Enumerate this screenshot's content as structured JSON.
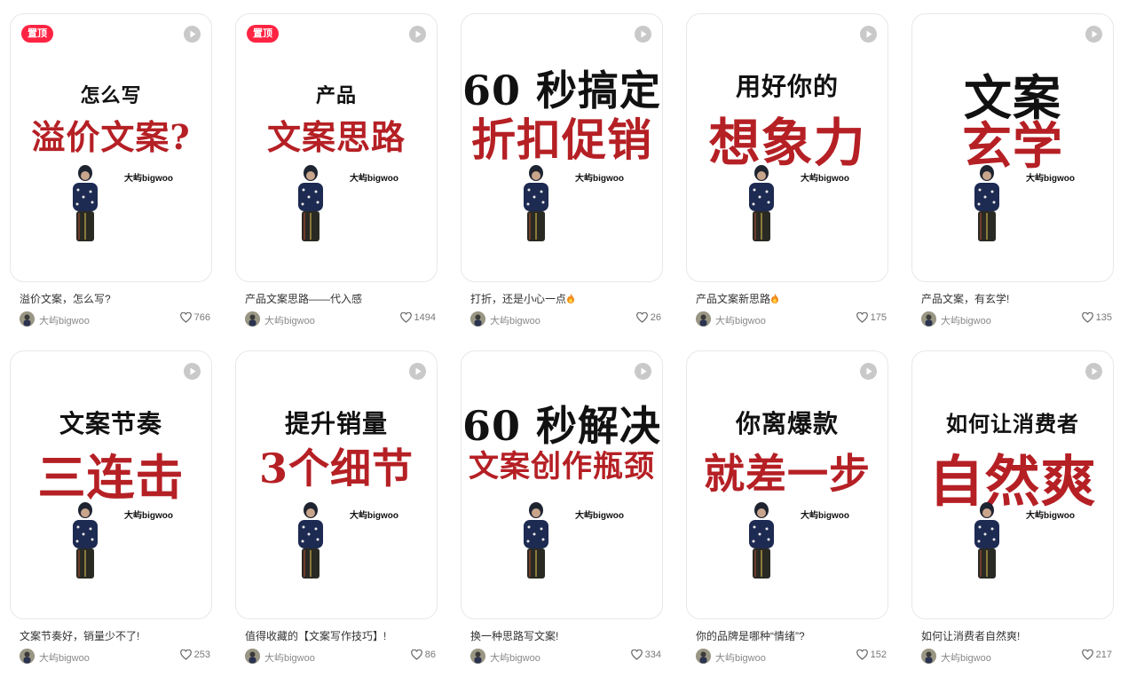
{
  "notes": [
    {
      "pinned": true,
      "pin_label": "置顶",
      "cover": [
        {
          "text": "怎么写",
          "color": "black"
        },
        {
          "text": "溢价文案?",
          "color": "red"
        }
      ],
      "brand": "大屿bigwoo",
      "title": "溢价文案，怎么写?",
      "fire": false,
      "author": "大屿bigwoo",
      "likes": "766"
    },
    {
      "pinned": true,
      "pin_label": "置顶",
      "cover": [
        {
          "text": "产品",
          "color": "black"
        },
        {
          "text": "文案思路",
          "color": "red"
        }
      ],
      "brand": "大屿bigwoo",
      "title": "产品文案思路——代入感",
      "fire": false,
      "author": "大屿bigwoo",
      "likes": "1494"
    },
    {
      "pinned": false,
      "cover": [
        {
          "text": "60 秒搞定",
          "color": "black"
        },
        {
          "text": "折扣促销",
          "color": "red"
        }
      ],
      "brand": "大屿bigwoo",
      "title": "打折，还是小心一点",
      "fire": true,
      "author": "大屿bigwoo",
      "likes": "26"
    },
    {
      "pinned": false,
      "cover": [
        {
          "text": "用好你的",
          "color": "black"
        },
        {
          "text": "想象力",
          "color": "red"
        }
      ],
      "brand": "大屿bigwoo",
      "title": "产品文案新思路",
      "fire": true,
      "author": "大屿bigwoo",
      "likes": "175"
    },
    {
      "pinned": false,
      "cover": [
        {
          "text": "文案",
          "color": "black"
        },
        {
          "text": "玄学",
          "color": "red"
        }
      ],
      "brand": "大屿bigwoo",
      "title": "产品文案，有玄学!",
      "fire": false,
      "author": "大屿bigwoo",
      "likes": "135"
    },
    {
      "pinned": false,
      "cover": [
        {
          "text": "文案节奏",
          "color": "black"
        },
        {
          "text": "三连击",
          "color": "red"
        }
      ],
      "brand": "大屿bigwoo",
      "title": "文案节奏好，销量少不了!",
      "fire": false,
      "author": "大屿bigwoo",
      "likes": "253"
    },
    {
      "pinned": false,
      "cover": [
        {
          "text": "提升销量",
          "color": "black"
        },
        {
          "text": "3个细节",
          "color": "red"
        }
      ],
      "brand": "大屿bigwoo",
      "title": "值得收藏的【文案写作技巧】!",
      "fire": false,
      "author": "大屿bigwoo",
      "likes": "86"
    },
    {
      "pinned": false,
      "cover": [
        {
          "text": "60 秒解决",
          "color": "black"
        },
        {
          "text": "文案创作瓶颈",
          "color": "red"
        }
      ],
      "brand": "大屿bigwoo",
      "title": "换一种思路写文案!",
      "fire": false,
      "author": "大屿bigwoo",
      "likes": "334"
    },
    {
      "pinned": false,
      "cover": [
        {
          "text": "你离爆款",
          "color": "black"
        },
        {
          "text": "就差一步",
          "color": "red"
        }
      ],
      "brand": "大屿bigwoo",
      "title": "你的品牌是哪种“情绪”?",
      "fire": false,
      "author": "大屿bigwoo",
      "likes": "152"
    },
    {
      "pinned": false,
      "cover": [
        {
          "text": "如何让消费者",
          "color": "black"
        },
        {
          "text": "自然爽",
          "color": "red"
        }
      ],
      "brand": "大屿bigwoo",
      "title": "如何让消费者自然爽!",
      "fire": false,
      "author": "大屿bigwoo",
      "likes": "217"
    }
  ],
  "icons": {
    "play": "play-icon",
    "heart": "heart-icon",
    "fire": "fire-emoji-icon"
  },
  "colors": {
    "pin_badge": "#ff2442",
    "cover_red": "#b52025",
    "cover_black": "#111111"
  }
}
